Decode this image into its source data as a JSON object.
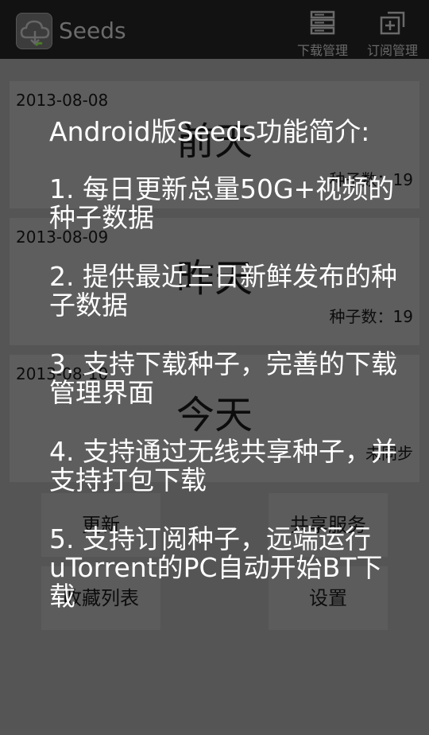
{
  "app": {
    "title": "Seeds",
    "icon": "cloud-download-icon"
  },
  "actions": [
    {
      "label": "下载管理",
      "icon": "download-manager-icon"
    },
    {
      "label": "订阅管理",
      "icon": "subscription-manager-icon"
    }
  ],
  "days": [
    {
      "date": "2013-08-08",
      "name": "前天",
      "count": "种子数：19"
    },
    {
      "date": "2013-08-09",
      "name": "昨天",
      "count": "种子数：19"
    },
    {
      "date": "2013-08-10",
      "name": "今天",
      "count": "未同步"
    }
  ],
  "buttons": {
    "update": "更新",
    "share": "共享服务",
    "favorites": "收藏列表",
    "settings": "设置"
  },
  "intro": {
    "title": "Android版Seeds功能简介:",
    "items": [
      "1. 每日更新总量50G+视频的种子数据",
      "2. 提供最近三日新鲜发布的种子数据",
      "3. 支持下载种子，完善的下载管理界面",
      "4. 支持通过无线共享种子，并支持打包下载",
      "5. 支持订阅种子，远端运行uTorrent的PC自动开始BT下载"
    ]
  },
  "colors": {
    "overlay_text": "#ffffff",
    "background": "#555555"
  }
}
